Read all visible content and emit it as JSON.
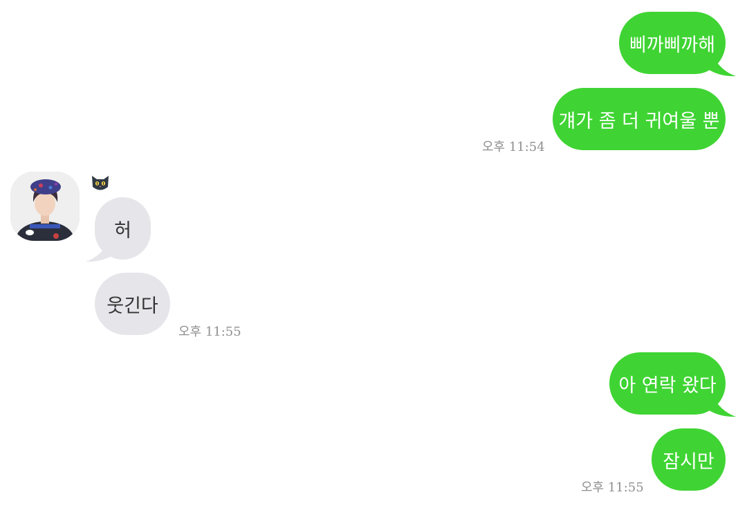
{
  "theme": {
    "outgoing_bubble": "#3fd433",
    "incoming_bubble": "#e5e5ea",
    "timestamp_color": "#8e8e8e"
  },
  "conversation": {
    "incoming_sender": {
      "avatar": "profile-photo",
      "name_icon": "black-cat-emoji"
    },
    "messages": [
      {
        "from": "me",
        "text": "삐까삐까해"
      },
      {
        "from": "me",
        "text": "걔가 좀 더 귀여울 뿐",
        "time": "오후 11:54"
      },
      {
        "from": "them",
        "text": "허"
      },
      {
        "from": "them",
        "text": "웃긴다",
        "time": "오후 11:55"
      },
      {
        "from": "me",
        "text": "아 연락 왔다"
      },
      {
        "from": "me",
        "text": "잠시만",
        "time": "오후 11:55"
      }
    ]
  }
}
